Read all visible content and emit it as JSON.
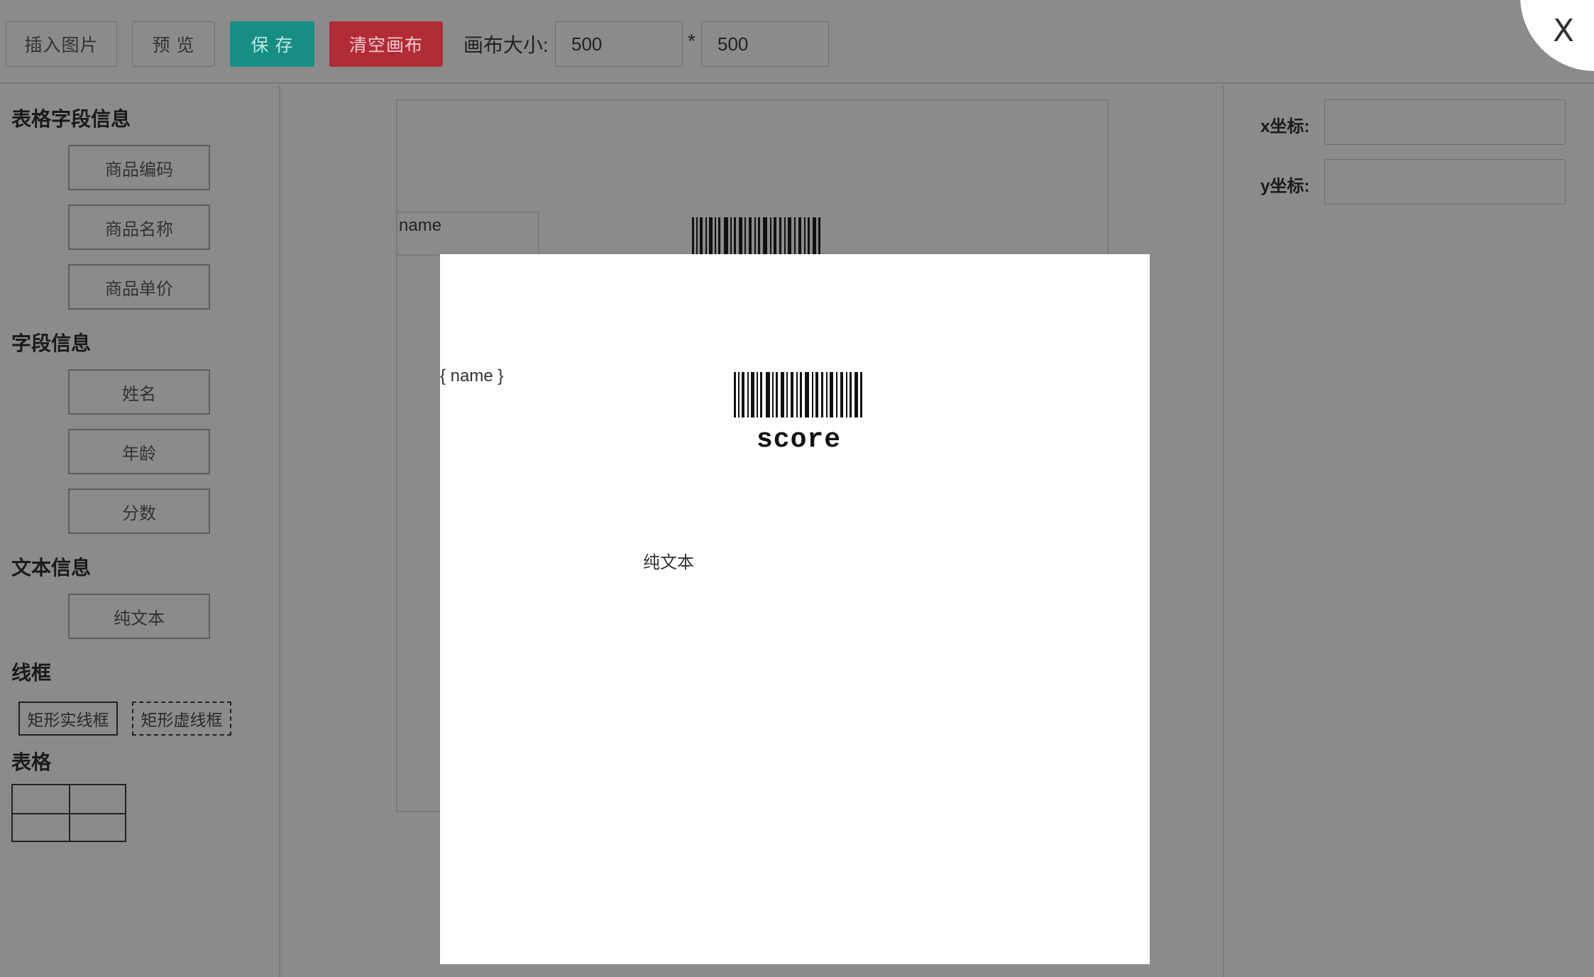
{
  "toolbar": {
    "insert_image": "插入图片",
    "preview": "预 览",
    "save": "保 存",
    "clear_canvas": "清空画布",
    "canvas_size_label": "画布大小:",
    "canvas_width": "500",
    "separator": "*",
    "canvas_height": "500",
    "close": "X"
  },
  "sidebar": {
    "table_fields_title": "表格字段信息",
    "table_fields": [
      "商品编码",
      "商品名称",
      "商品单价"
    ],
    "fields_title": "字段信息",
    "fields": [
      "姓名",
      "年龄",
      "分数"
    ],
    "text_title": "文本信息",
    "text_items": [
      "纯文本"
    ],
    "frame_title": "线框",
    "frame_solid": "矩形实线框",
    "frame_dashed": "矩形虚线框",
    "table_title": "表格"
  },
  "canvas": {
    "name_box_text": "name"
  },
  "props": {
    "x_label": "x坐标:",
    "y_label": "y坐标:",
    "x_value": "",
    "y_value": ""
  },
  "preview": {
    "name_text": "{ name }",
    "barcode_text": "score",
    "plain_text": "纯文本"
  },
  "colors": {
    "backdrop": "#8b8b8b",
    "save_button": "#178e84",
    "clear_button": "#b12c36",
    "preview_bg": "#ffffff"
  }
}
